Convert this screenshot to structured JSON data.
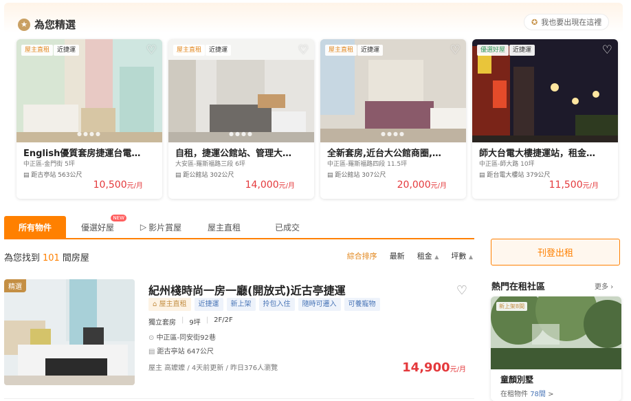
{
  "featured": {
    "title": "為您精選",
    "promo_label": "我也要出現在這裡",
    "cards": [
      {
        "tag1": "屋主直租",
        "tag2": "近捷運",
        "title": "English優質套房捷運台電…",
        "sub": "中正區-金門街 5坪",
        "dist": "距古亭站 563公尺",
        "price": "10,500",
        "unit": "元/月"
      },
      {
        "tag1": "屋主直租",
        "tag2": "近捷運",
        "title": "自租，捷運公館站、管理大…",
        "sub": "大安區-羅斯福路三段 6坪",
        "dist": "距公館站 302公尺",
        "price": "14,000",
        "unit": "元/月"
      },
      {
        "tag1": "屋主直租",
        "tag2": "近捷運",
        "title": "全新套房,近台大公館商圈,…",
        "sub": "中正區-羅斯福路四段 11.5坪",
        "dist": "距公館站 307公尺",
        "price": "20,000",
        "unit": "元/月"
      },
      {
        "tag1": "優選好屋",
        "tag2": "近捷運",
        "title": "師大台電大樓捷運站，租金…",
        "sub": "中正區-師大路 10坪",
        "dist": "距台電大樓站 379公尺",
        "price": "11,500",
        "unit": "元/月"
      }
    ]
  },
  "tabs": [
    {
      "label": "所有物件"
    },
    {
      "label": "優選好屋",
      "badge": "NEW"
    },
    {
      "label": "影片賞屋"
    },
    {
      "label": "屋主直租"
    },
    {
      "label": "已成交"
    }
  ],
  "results": {
    "prefix": "為您找到",
    "count": "101",
    "suffix": "間房屋"
  },
  "sort": {
    "s1": "綜合排序",
    "s2": "最新",
    "s3": "租金",
    "s4": "坪數"
  },
  "listing": {
    "badge": "精選",
    "title": "紀州棧時尚一房一廳(開放式)近古亭捷運",
    "pills": [
      "屋主直租",
      "近捷運",
      "新上架",
      "拎包入住",
      "隨時可遷入",
      "可養寵物"
    ],
    "type": "獨立套房",
    "area": "9坪",
    "floor": "2F/2F",
    "address": "中正區-同安街92巷",
    "near": "距古亭站 647公尺",
    "meta": "屋主 高嬤嬤 / 4天前更新 / 昨日376人瀏覽",
    "price": "14,900",
    "unit": "元/月"
  },
  "sidebar": {
    "post_label": "刊登出租",
    "hot_title": "熱門在租社區",
    "more_label": "更多",
    "community": {
      "badge": "新上架8間",
      "name": "童顏別墅",
      "count_prefix": "在租物件",
      "count": "78間",
      "count_suffix": ">"
    }
  }
}
